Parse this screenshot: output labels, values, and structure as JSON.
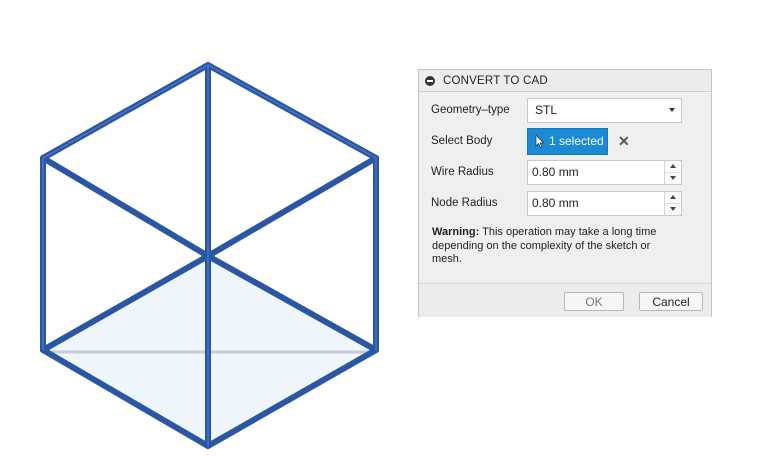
{
  "dialog": {
    "title": "CONVERT TO CAD",
    "geometry_type": {
      "label": "Geometry–type",
      "value": "STL"
    },
    "select_body": {
      "label": "Select Body",
      "button_label": "1 selected"
    },
    "wire_radius": {
      "label": "Wire Radius",
      "value": "0.80 mm"
    },
    "node_radius": {
      "label": "Node Radius",
      "value": "0.80 mm"
    },
    "warning": {
      "prefix": "Warning:",
      "text": "This operation may take a long time depending on the complexity of the sketch or mesh."
    },
    "buttons": {
      "ok": "OK",
      "cancel": "Cancel"
    }
  },
  "colors": {
    "wire": "#2b56a4",
    "face_fill": "#eef6fc",
    "selected_button": "#1a8ad6"
  },
  "icons": {
    "header": "collapse-circle-icon",
    "select": "pointer-cursor-icon",
    "clear": "clear-x-icon",
    "dropdown": "chevron-down-icon",
    "spinner": "spinner-arrows-icon"
  }
}
